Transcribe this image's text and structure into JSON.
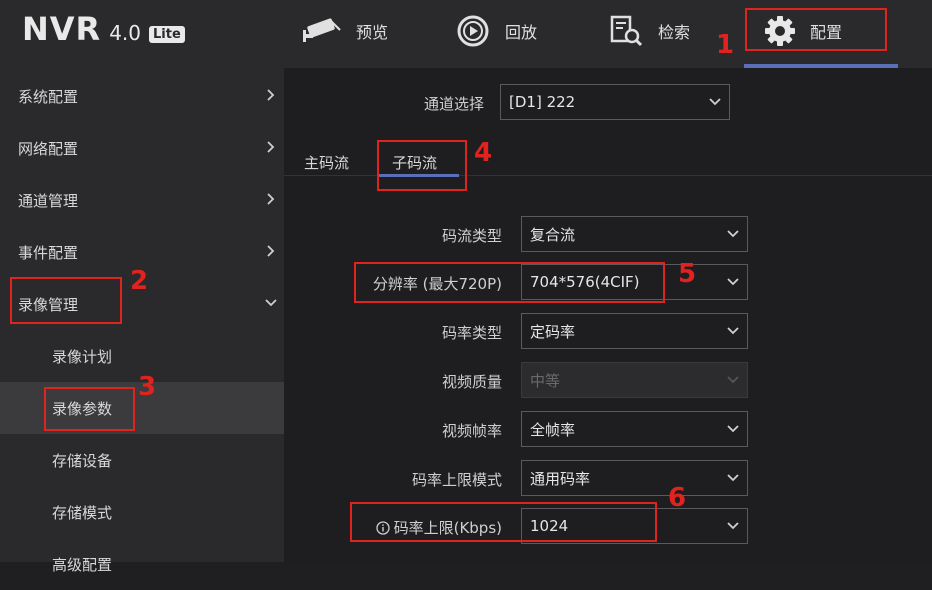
{
  "header": {
    "logo_nvr": "NVR",
    "logo_version": "4.0",
    "logo_badge": "Lite",
    "nav": [
      {
        "label": "预览",
        "icon": "camera-icon"
      },
      {
        "label": "回放",
        "icon": "playback-icon"
      },
      {
        "label": "检索",
        "icon": "search-doc-icon"
      },
      {
        "label": "配置",
        "icon": "gear-icon"
      }
    ],
    "active_nav": "配置"
  },
  "sidebar": {
    "items": [
      {
        "label": "系统配置"
      },
      {
        "label": "网络配置"
      },
      {
        "label": "通道管理"
      },
      {
        "label": "事件配置"
      },
      {
        "label": "录像管理"
      }
    ],
    "subitems": [
      {
        "label": "录像计划"
      },
      {
        "label": "录像参数"
      },
      {
        "label": "存储设备"
      },
      {
        "label": "存储模式"
      },
      {
        "label": "高级配置"
      }
    ]
  },
  "main": {
    "channel_label": "通道选择",
    "channel_value": "[D1] 222",
    "tabs": [
      "主码流",
      "子码流"
    ],
    "active_tab": "子码流",
    "fields": [
      {
        "label": "码流类型",
        "value": "复合流"
      },
      {
        "label": "分辨率 (最大720P)",
        "value": "704*576(4CIF)"
      },
      {
        "label": "码率类型",
        "value": "定码率"
      },
      {
        "label": "视频质量",
        "value": "中等"
      },
      {
        "label": "视频帧率",
        "value": "全帧率"
      },
      {
        "label": "码率上限模式",
        "value": "通用码率"
      },
      {
        "label": "码率上限(Kbps)",
        "value": "1024"
      }
    ]
  },
  "annotations": [
    "1",
    "2",
    "3",
    "4",
    "5",
    "6"
  ],
  "colors": {
    "accent": "#5a6fb8",
    "annotation_red": "#e0231f"
  }
}
